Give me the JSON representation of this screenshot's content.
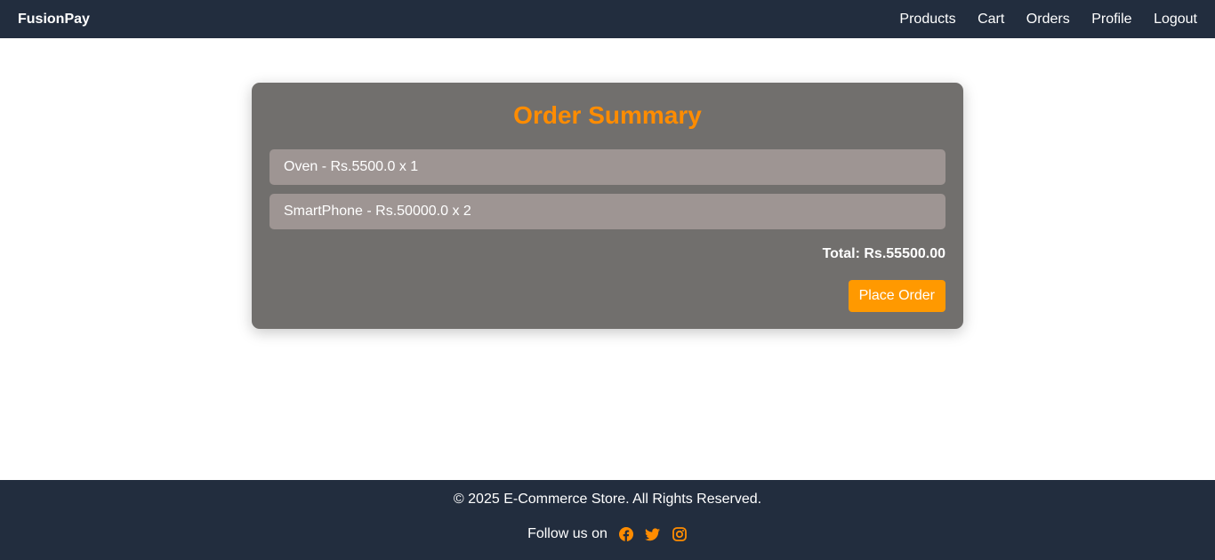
{
  "navbar": {
    "brand": "FusionPay",
    "links": [
      "Products",
      "Cart",
      "Orders",
      "Profile",
      "Logout"
    ]
  },
  "order": {
    "title": "Order Summary",
    "items": [
      "Oven - Rs.5500.0 x 1",
      "SmartPhone - Rs.50000.0 x 2"
    ],
    "total": "Total: Rs.55500.00",
    "button_label": "Place Order"
  },
  "footer": {
    "copyright": "© 2025 E-Commerce Store. All Rights Reserved.",
    "follow_label": "Follow us on",
    "social_icons": [
      "facebook-icon",
      "twitter-icon",
      "instagram-icon"
    ]
  },
  "colors": {
    "nav_bg": "#222d3e",
    "accent": "#ff8c00",
    "button": "#ff9900",
    "card_bg": "#716f6d",
    "item_bg": "#9e9593"
  }
}
